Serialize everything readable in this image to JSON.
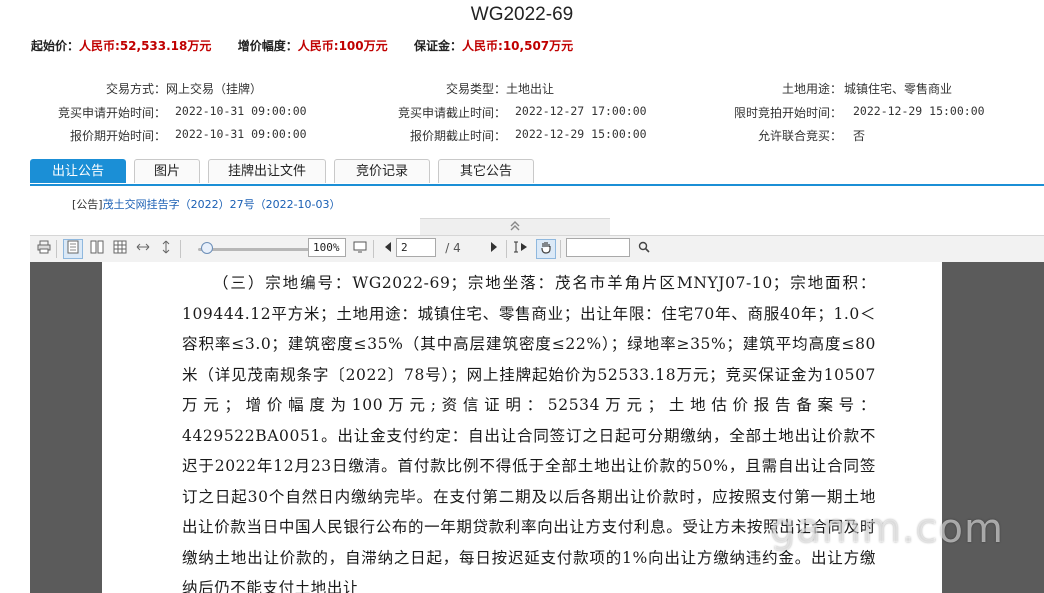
{
  "title": "WG2022-69",
  "price": {
    "start_label": "起始价：",
    "start_value": "人民币:52,533.18万元",
    "increment_label": "增价幅度：",
    "increment_value": "人民币:100万元",
    "deposit_label": "保证金：",
    "deposit_value": "人民币:10,507万元"
  },
  "info": {
    "trade_method_label": "交易方式：",
    "trade_method_value": "网上交易（挂牌）",
    "trade_type_label": "交易类型：",
    "trade_type_value": "土地出让",
    "land_use_label": "土地用途：",
    "land_use_value": "城镇住宅、零售商业",
    "apply_start_label": "竞买申请开始时间：",
    "apply_start_value": "2022-10-31 09:00:00",
    "apply_end_label": "竞买申请截止时间：",
    "apply_end_value": "2022-12-27 17:00:00",
    "auction_time_label": "限时竞拍开始时间：",
    "auction_time_value": "2022-12-29 15:00:00",
    "quote_start_label": "报价期开始时间：",
    "quote_start_value": "2022-10-31 09:00:00",
    "quote_end_label": "报价期截止时间：",
    "quote_end_value": "2022-12-29 15:00:00",
    "joint_label": "允许联合竞买：",
    "joint_value": "否"
  },
  "tabs": [
    "出让公告",
    "图片",
    "挂牌出让文件",
    "竞价记录",
    "其它公告"
  ],
  "notice": {
    "tag": "[公告]",
    "link": "茂土交网挂告字（2022）27号（2022-10-03）"
  },
  "collapse_icon": "chevron-double-up-icon",
  "toolbar": {
    "zoom": "100%",
    "page_current": "2",
    "page_total": "/ 4",
    "search_value": ""
  },
  "document": {
    "text": "（三）宗地编号：WG2022-69；宗地坐落：茂名市羊角片区MNYJ07-10；宗地面积：109444.12平方米；土地用途：城镇住宅、零售商业；出让年限：住宅70年、商服40年；1.0＜容积率≤3.0；建筑密度≤35%（其中高层建筑密度≤22%）；绿地率≥35%；建筑平均高度≤80米（详见茂南规条字〔2022〕78号）；网上挂牌起始价为52533.18万元；竞买保证金为10507万元；增价幅度为100万元;资信证明：52534万元；土地估价报告备案号：4429522BA0051。出让金支付约定：自出让合同签订之日起可分期缴纳，全部土地出让价款不迟于2022年12月23日缴清。首付款比例不得低于全部土地出让价款的50%，且需自出让合同签订之日起30个自然日内缴纳完毕。在支付第二期及以后各期出让价款时，应按照支付第一期土地出让价款当日中国人民银行公布的一年期贷款利率向出让方支付利息。受让方未按照出让合同及时缴纳土地出让价款的，自滞纳之日起，每日按迟延支付款项的1%向出让方缴纳违约金。出让方缴纳后仍不能支付土地出让"
  },
  "watermark": "gamm.com",
  "colors": {
    "accent": "#1b8fd6",
    "price_red": "#c00000",
    "viewer_bg": "#5b5b5b"
  }
}
